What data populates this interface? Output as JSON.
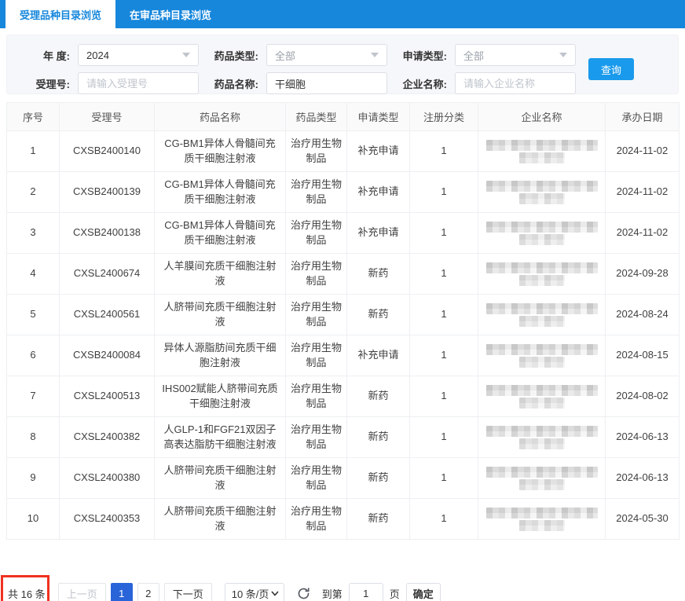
{
  "tabs": [
    {
      "label": "受理品种目录浏览",
      "active": true
    },
    {
      "label": "在审品种目录浏览",
      "active": false
    }
  ],
  "search": {
    "year": {
      "label": "年  度:",
      "value": "2024"
    },
    "drug_type": {
      "label": "药品类型:",
      "value": "全部"
    },
    "app_type": {
      "label": "申请类型:",
      "value": "全部"
    },
    "accept_no": {
      "label": "受理号:",
      "value": "",
      "placeholder": "请输入受理号"
    },
    "drug_name": {
      "label": "药品名称:",
      "value": "干细胞",
      "placeholder": ""
    },
    "company": {
      "label": "企业名称:",
      "value": "",
      "placeholder": "请输入企业名称"
    },
    "query_button": "查询"
  },
  "table": {
    "columns": [
      "序号",
      "受理号",
      "药品名称",
      "药品类型",
      "申请类型",
      "注册分类",
      "企业名称",
      "承办日期"
    ],
    "rows": [
      {
        "no": "1",
        "accept_no": "CXSB2400140",
        "drug_name": "CG-BM1异体人骨髓间充质干细胞注射液",
        "drug_type": "治疗用生物制品",
        "app_type": "补充申请",
        "reg_class": "1",
        "company_redacted": true,
        "date": "2024-11-02"
      },
      {
        "no": "2",
        "accept_no": "CXSB2400139",
        "drug_name": "CG-BM1异体人骨髓间充质干细胞注射液",
        "drug_type": "治疗用生物制品",
        "app_type": "补充申请",
        "reg_class": "1",
        "company_redacted": true,
        "date": "2024-11-02"
      },
      {
        "no": "3",
        "accept_no": "CXSB2400138",
        "drug_name": "CG-BM1异体人骨髓间充质干细胞注射液",
        "drug_type": "治疗用生物制品",
        "app_type": "补充申请",
        "reg_class": "1",
        "company_redacted": true,
        "date": "2024-11-02"
      },
      {
        "no": "4",
        "accept_no": "CXSL2400674",
        "drug_name": "人羊膜间充质干细胞注射液",
        "drug_type": "治疗用生物制品",
        "app_type": "新药",
        "reg_class": "1",
        "company_redacted": true,
        "date": "2024-09-28"
      },
      {
        "no": "5",
        "accept_no": "CXSL2400561",
        "drug_name": "人脐带间充质干细胞注射液",
        "drug_type": "治疗用生物制品",
        "app_type": "新药",
        "reg_class": "1",
        "company_redacted": true,
        "date": "2024-08-24"
      },
      {
        "no": "6",
        "accept_no": "CXSB2400084",
        "drug_name": "异体人源脂肪间充质干细胞注射液",
        "drug_type": "治疗用生物制品",
        "app_type": "补充申请",
        "reg_class": "1",
        "company_redacted": true,
        "date": "2024-08-15"
      },
      {
        "no": "7",
        "accept_no": "CXSL2400513",
        "drug_name": "IHS002赋能人脐带间充质干细胞注射液",
        "drug_type": "治疗用生物制品",
        "app_type": "新药",
        "reg_class": "1",
        "company_redacted": true,
        "date": "2024-08-02"
      },
      {
        "no": "8",
        "accept_no": "CXSL2400382",
        "drug_name": "人GLP-1和FGF21双因子高表达脂肪干细胞注射液",
        "drug_type": "治疗用生物制品",
        "app_type": "新药",
        "reg_class": "1",
        "company_redacted": true,
        "date": "2024-06-13"
      },
      {
        "no": "9",
        "accept_no": "CXSL2400380",
        "drug_name": "人脐带间充质干细胞注射液",
        "drug_type": "治疗用生物制品",
        "app_type": "新药",
        "reg_class": "1",
        "company_redacted": true,
        "date": "2024-06-13"
      },
      {
        "no": "10",
        "accept_no": "CXSL2400353",
        "drug_name": "人脐带间充质干细胞注射液",
        "drug_type": "治疗用生物制品",
        "app_type": "新药",
        "reg_class": "1",
        "company_redacted": true,
        "date": "2024-05-30"
      }
    ]
  },
  "pagination": {
    "total_text": "共 16 条",
    "prev_label": "上一页",
    "page_buttons": [
      "1",
      "2"
    ],
    "active_page": "1",
    "next_label": "下一页",
    "page_size_label": "10 条/页",
    "goto_prefix": "到第",
    "goto_value": "1",
    "goto_suffix": "页",
    "confirm_label": "确定"
  },
  "colors": {
    "topbar_blue": "#1787DC",
    "query_button_blue": "#1A9AEC",
    "active_page_blue": "#2A64D9",
    "annotation_red": "#F0311F"
  }
}
